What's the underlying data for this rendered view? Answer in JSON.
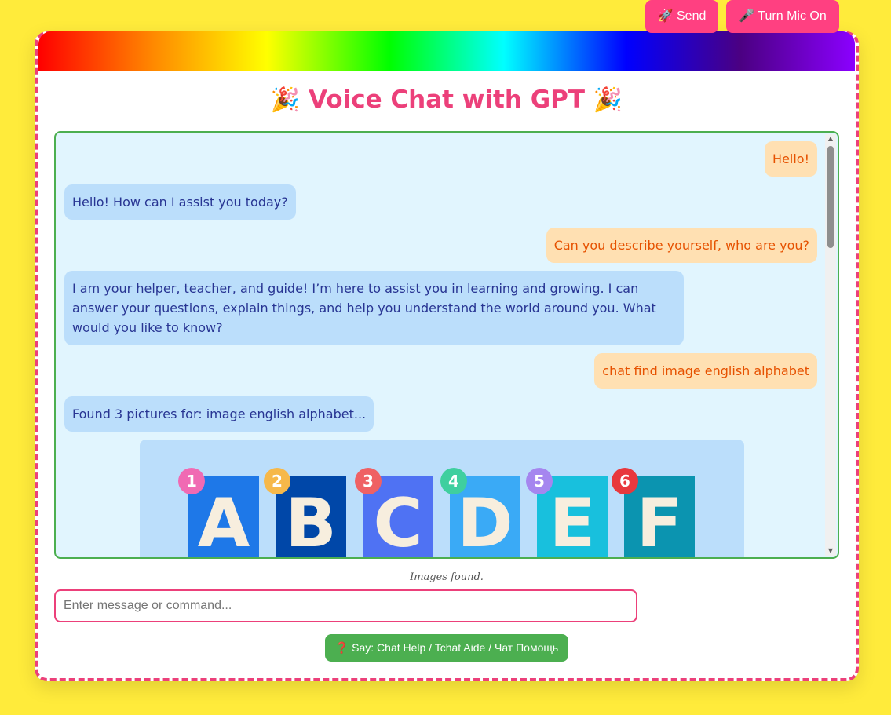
{
  "app": {
    "title": "Voice Chat with GPT",
    "title_emoji": "🎉"
  },
  "chat": {
    "messages": [
      {
        "role": "user",
        "text": "Hello!"
      },
      {
        "role": "bot",
        "text": "Hello! How can I assist you today?"
      },
      {
        "role": "user",
        "text": "Can you describe yourself, who are you?"
      },
      {
        "role": "bot",
        "text": "I am your helper, teacher, and guide! I’m here to assist you in learning and growing. I can answer your questions, explain things, and help you understand the world around you. What would you like to know?"
      },
      {
        "role": "user",
        "text": "chat find image english alphabet"
      },
      {
        "role": "bot",
        "text": "Found 3 pictures for: image english alphabet..."
      }
    ],
    "image_tiles": [
      {
        "number": "1",
        "letter": "A",
        "tile_color": "#1e78e8",
        "badge_color": "#f06ab3"
      },
      {
        "number": "2",
        "letter": "B",
        "tile_color": "#0047a8",
        "badge_color": "#f6b84a"
      },
      {
        "number": "3",
        "letter": "C",
        "tile_color": "#4f72f3",
        "badge_color": "#ef6164"
      },
      {
        "number": "4",
        "letter": "D",
        "tile_color": "#3aaaf6",
        "badge_color": "#3fcf9f"
      },
      {
        "number": "5",
        "letter": "E",
        "tile_color": "#18c0dd",
        "badge_color": "#a586ef"
      },
      {
        "number": "6",
        "letter": "F",
        "tile_color": "#0b94b0",
        "badge_color": "#e8383d"
      }
    ]
  },
  "status": {
    "text": "Images found."
  },
  "input": {
    "placeholder": "Enter message or command...",
    "value": ""
  },
  "buttons": {
    "send_icon": "🚀",
    "send_label": "Send",
    "mic_icon": "🎤",
    "mic_label": "Turn Mic On",
    "help_icon": "❓",
    "help_label": "Say: Chat Help / Tchat Aide / Чат Помощь"
  },
  "colors": {
    "background": "#ffeb3b",
    "accent": "#ec407a",
    "chat_border": "#4caf50",
    "button": "#ff4081",
    "help_button": "#4caf50"
  }
}
